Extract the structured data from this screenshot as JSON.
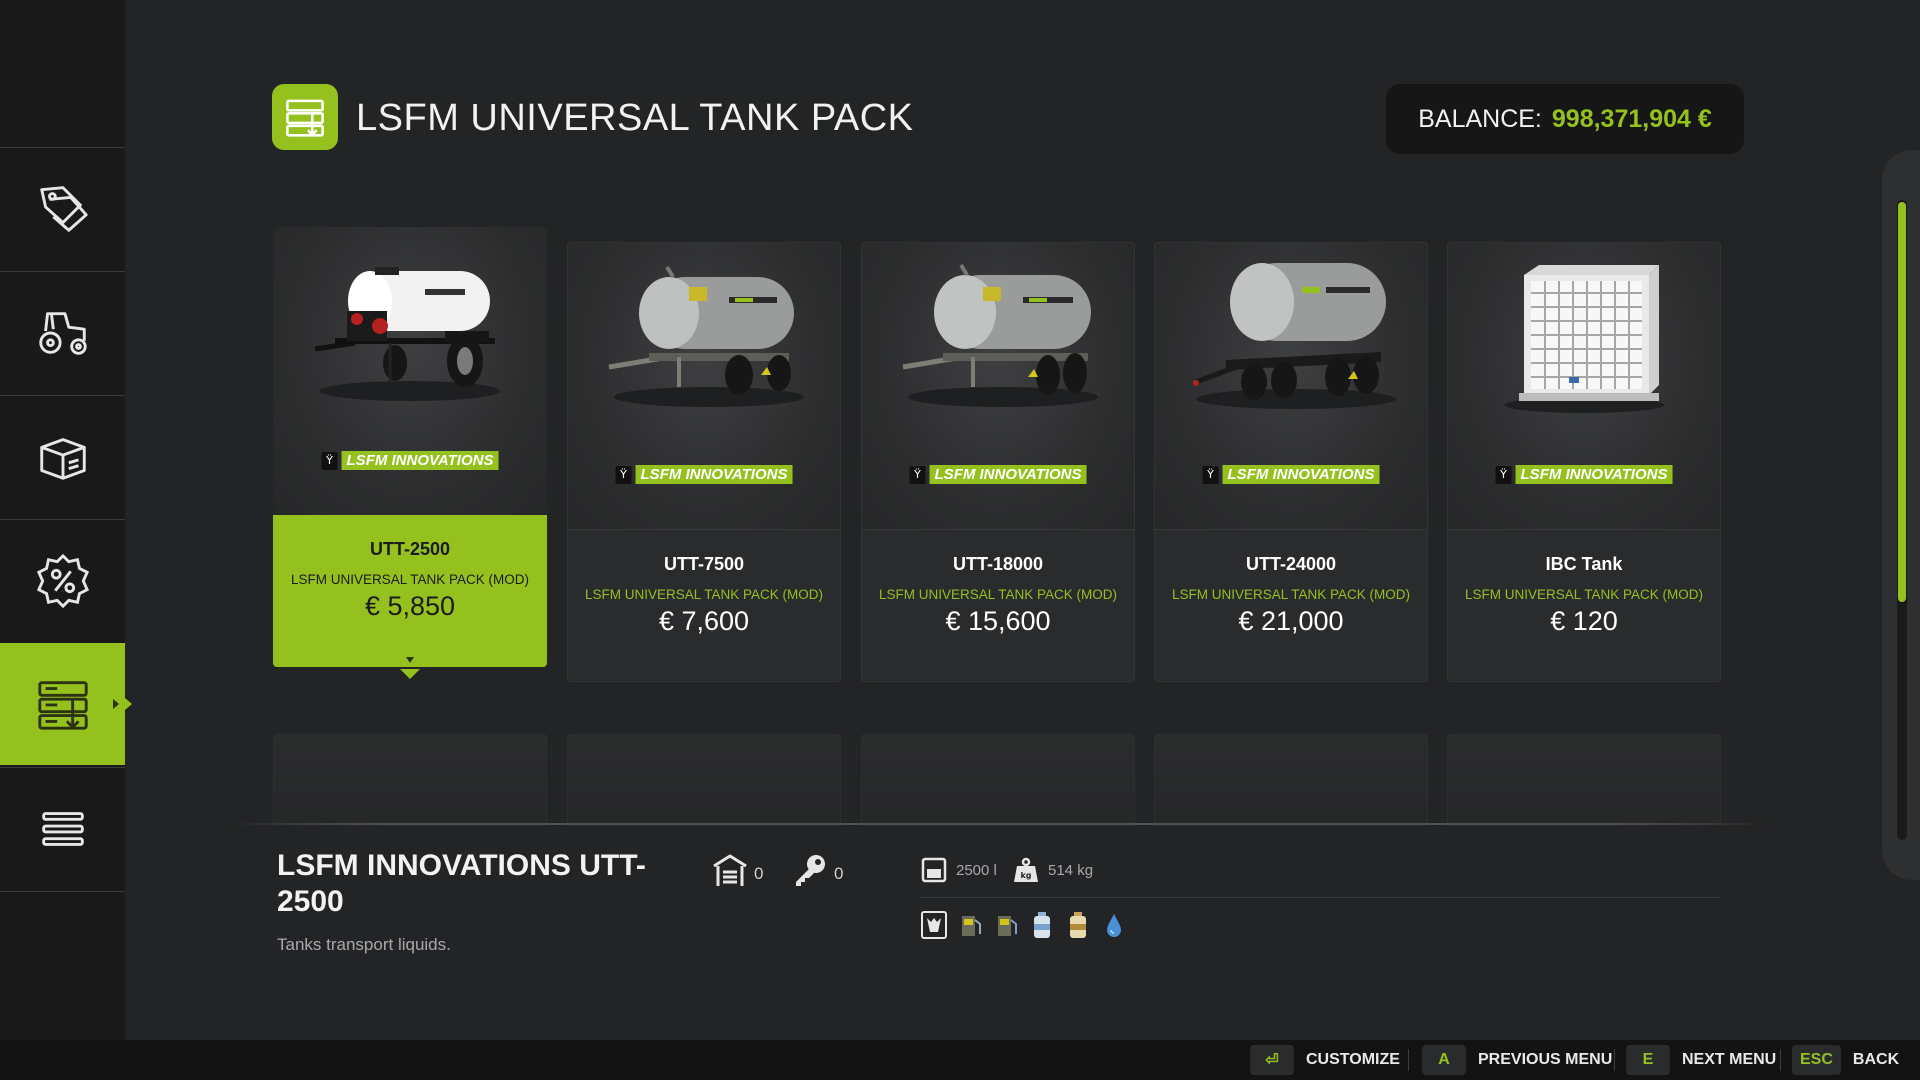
{
  "header": {
    "title": "LSFM UNIVERSAL TANK PACK",
    "icon": "tank-pack-icon",
    "balance_label": "BALANCE:",
    "balance_value": "998,371,904 €"
  },
  "sidebar": {
    "items": [
      {
        "name": "sidebar-item-sales",
        "icon": "price-tags-icon"
      },
      {
        "name": "sidebar-item-vehicles",
        "icon": "tractor-icon"
      },
      {
        "name": "sidebar-item-objects",
        "icon": "box-icon"
      },
      {
        "name": "sidebar-item-sale-offers",
        "icon": "percent-badge-icon"
      },
      {
        "name": "sidebar-item-mod-packs",
        "icon": "tank-pack-icon",
        "active": true
      },
      {
        "name": "sidebar-item-menu",
        "icon": "list-icon"
      }
    ]
  },
  "cards": [
    {
      "name": "UTT-2500",
      "pack": "LSFM UNIVERSAL TANK PACK (MOD)",
      "price": "€ 5,850",
      "brand": "LSFM INNOVATIONS",
      "selected": true
    },
    {
      "name": "UTT-7500",
      "pack": "LSFM UNIVERSAL TANK PACK (MOD)",
      "price": "€ 7,600",
      "brand": "LSFM INNOVATIONS"
    },
    {
      "name": "UTT-18000",
      "pack": "LSFM UNIVERSAL TANK PACK (MOD)",
      "price": "€ 15,600",
      "brand": "LSFM INNOVATIONS"
    },
    {
      "name": "UTT-24000",
      "pack": "LSFM UNIVERSAL TANK PACK (MOD)",
      "price": "€ 21,000",
      "brand": "LSFM INNOVATIONS"
    },
    {
      "name": "IBC Tank",
      "pack": "LSFM UNIVERSAL TANK PACK (MOD)",
      "price": "€ 120",
      "brand": "LSFM INNOVATIONS"
    }
  ],
  "detail": {
    "title": "LSFM INNOVATIONS UTT-2500",
    "description": "Tanks transport liquids.",
    "owned_count": "0",
    "leased_count": "0",
    "capacity": "2500 l",
    "weight": "514 kg",
    "fill_types": [
      "milk-icon",
      "diesel-icon",
      "def-icon",
      "water-bottle-icon",
      "liquid-fertilizer-icon",
      "water-drop-icon"
    ]
  },
  "colors": {
    "accent": "#95c11f",
    "background": "#232425",
    "sidebar": "#19191a",
    "card": "#2a2b2c"
  },
  "footer": {
    "hints": [
      {
        "key": "⏎",
        "label": "CUSTOMIZE"
      },
      {
        "key": "A",
        "label": "PREVIOUS MENU"
      },
      {
        "key": "E",
        "label": "NEXT MENU"
      },
      {
        "key": "ESC",
        "label": "BACK"
      }
    ]
  }
}
